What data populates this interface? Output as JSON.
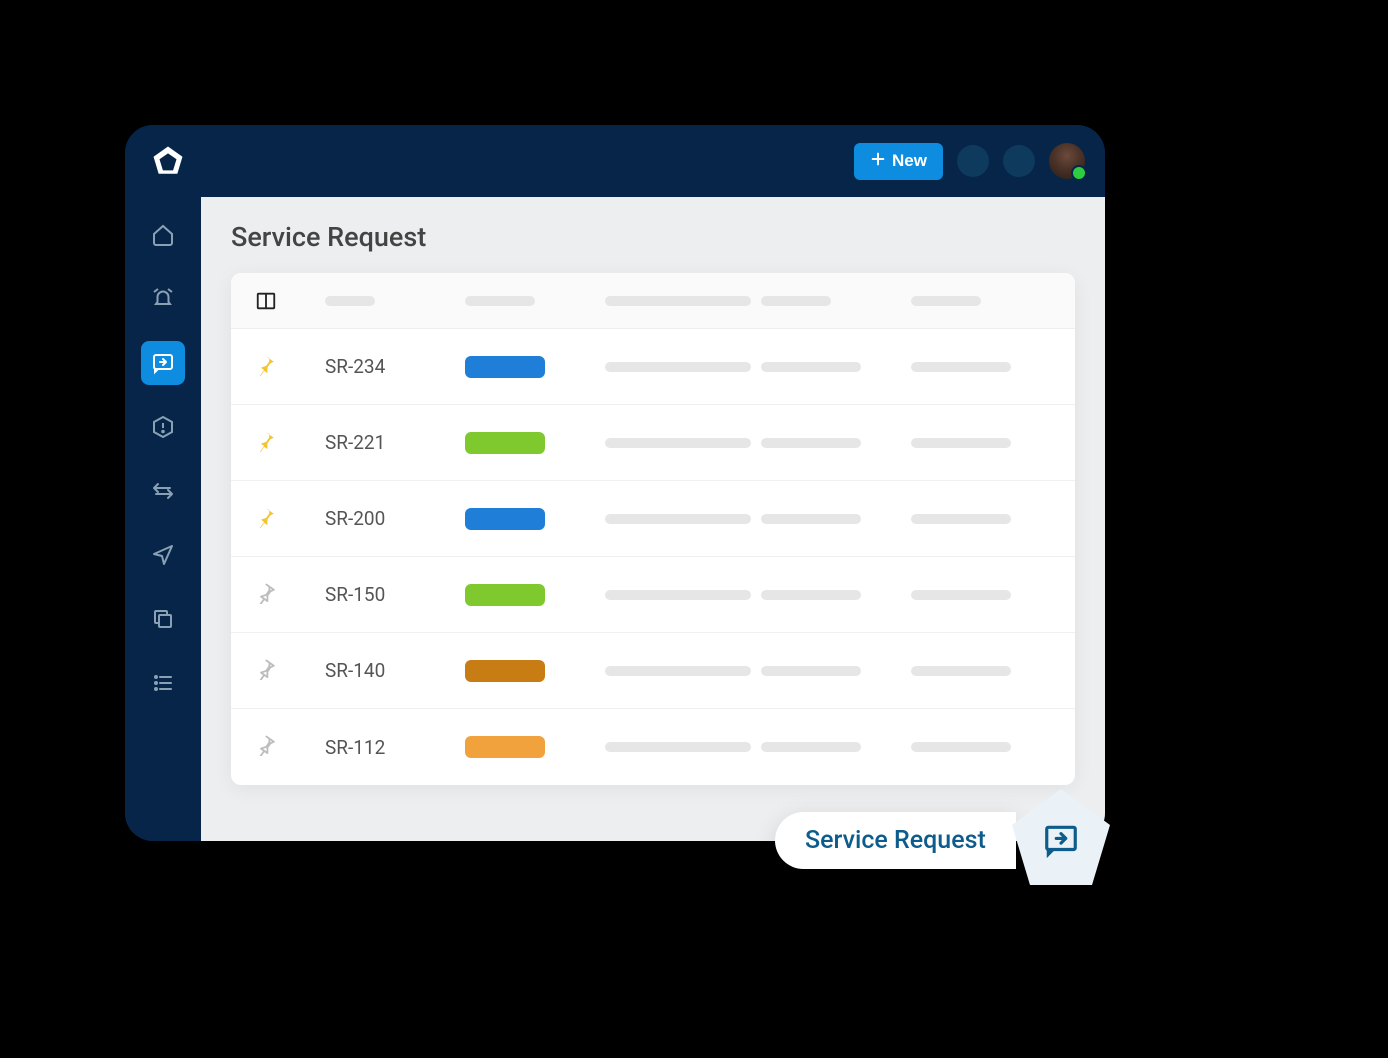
{
  "header": {
    "new_button_label": "New"
  },
  "sidebar": {
    "items": [
      {
        "name": "home",
        "active": false
      },
      {
        "name": "alerts",
        "active": false
      },
      {
        "name": "service-request",
        "active": true
      },
      {
        "name": "incidents",
        "active": false
      },
      {
        "name": "changes",
        "active": false
      },
      {
        "name": "navigation",
        "active": false
      },
      {
        "name": "copy",
        "active": false
      },
      {
        "name": "list",
        "active": false
      }
    ]
  },
  "page": {
    "title": "Service Request"
  },
  "table": {
    "rows": [
      {
        "id": "SR-234",
        "pinned": true,
        "status_color": "blue"
      },
      {
        "id": "SR-221",
        "pinned": true,
        "status_color": "green"
      },
      {
        "id": "SR-200",
        "pinned": true,
        "status_color": "blue"
      },
      {
        "id": "SR-150",
        "pinned": false,
        "status_color": "green"
      },
      {
        "id": "SR-140",
        "pinned": false,
        "status_color": "brown"
      },
      {
        "id": "SR-112",
        "pinned": false,
        "status_color": "orange"
      }
    ]
  },
  "tooltip": {
    "label": "Service Request"
  },
  "colors": {
    "brand_dark": "#072549",
    "accent": "#0d8ce0",
    "status_blue": "#1f7ed8",
    "status_green": "#7fc92e",
    "status_brown": "#c77d14",
    "status_orange": "#f2a23c"
  }
}
